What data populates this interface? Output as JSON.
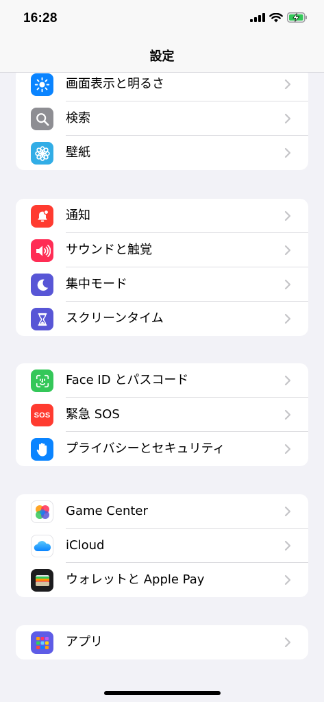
{
  "status_bar": {
    "time": "16:28",
    "icons": [
      "cellular-signal-icon",
      "wifi-icon",
      "battery-charging-icon"
    ],
    "battery_color": "#34c759"
  },
  "nav": {
    "title": "設定"
  },
  "groups": [
    {
      "items": [
        {
          "label": "画面表示と明るさ",
          "icon": "brightness-sun-icon",
          "color": "#0a84ff"
        },
        {
          "label": "検索",
          "icon": "magnifier-icon",
          "color": "#8e8e93"
        },
        {
          "label": "壁紙",
          "icon": "flower-icon",
          "color": "#32ade6"
        }
      ]
    },
    {
      "items": [
        {
          "label": "通知",
          "icon": "notification-bell-icon",
          "color": "#ff3b30"
        },
        {
          "label": "サウンドと触覚",
          "icon": "speaker-icon",
          "color": "#ff2d55"
        },
        {
          "label": "集中モード",
          "icon": "moon-icon",
          "color": "#5856d6"
        },
        {
          "label": "スクリーンタイム",
          "icon": "hourglass-icon",
          "color": "#5856d6"
        }
      ]
    },
    {
      "items": [
        {
          "label": "Face ID とパスコード",
          "icon": "face-id-icon",
          "color": "#34c759"
        },
        {
          "label": "緊急 SOS",
          "icon": "sos-icon",
          "icon_text": "SOS",
          "color": "#ff3b30"
        },
        {
          "label": "プライバシーとセキュリティ",
          "icon": "hand-icon",
          "color": "#0a84ff"
        }
      ]
    },
    {
      "items": [
        {
          "label": "Game Center",
          "icon": "game-center-icon",
          "color": "#ffffff"
        },
        {
          "label": "iCloud",
          "icon": "icloud-icon",
          "color": "#ffffff"
        },
        {
          "label": "ウォレットと Apple Pay",
          "icon": "wallet-icon",
          "color": "#1c1c1e"
        }
      ]
    },
    {
      "items": [
        {
          "label": "アプリ",
          "icon": "apps-grid-icon",
          "color": "#5e5ce6"
        }
      ]
    }
  ]
}
